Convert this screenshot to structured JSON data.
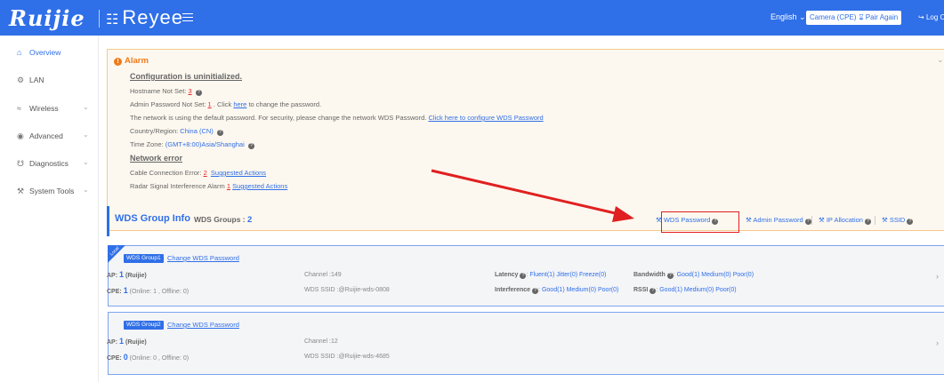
{
  "header": {
    "brand": "Ruijie",
    "product": "Reyee",
    "language": "English",
    "mode": "Camera (CPE)",
    "pair": "Pair Again",
    "logout": "Log O"
  },
  "sidebar": {
    "items": [
      {
        "label": "Overview",
        "icon": "home-icon"
      },
      {
        "label": "LAN",
        "icon": "gear-icon"
      },
      {
        "label": "Wireless",
        "icon": "wifi-icon"
      },
      {
        "label": "Advanced",
        "icon": "globe-icon"
      },
      {
        "label": "Diagnostics",
        "icon": "diagnostics-icon"
      },
      {
        "label": "System Tools",
        "icon": "tools-icon"
      }
    ]
  },
  "alarm": {
    "title": "Alarm",
    "config_heading": "Configuration is uninitialized.",
    "hostname_label": "Hostname Not Set:",
    "hostname_count": "3",
    "admin_label": "Admin Password Not Set:",
    "admin_count": "1",
    "admin_click": ". Click",
    "admin_here": "here",
    "admin_rest": "to change the password.",
    "network_msg": "The network is using the default password. For security, please change the network WDS Password.",
    "network_link": "Click here to configure WDS Password",
    "country_label": "Country/Region:",
    "country_value": "China (CN)",
    "timezone_label": "Time Zone:",
    "timezone_value": "(GMT+8:00)Asia/Shanghai",
    "network_error_heading": "Network error",
    "cable_label": "Cable Connection Error:",
    "cable_count": "2",
    "cable_link": "Suggested Actions",
    "radar_label": "Radar Signal Interference Alarm",
    "radar_count": "1",
    "radar_link": "Suggested Actions"
  },
  "wds": {
    "title": "WDS Group Info",
    "groups_label": "WDS Groups :",
    "groups_count": "2",
    "tools": {
      "wds_password": "WDS Password",
      "admin_password": "Admin Password",
      "ip_allocation": "IP Allocation",
      "ssid": "SSID"
    },
    "local_tag": "Local",
    "change_label": "Change WDS Password",
    "groups": [
      {
        "name": "WDS Group1",
        "ap_label": "AP:",
        "ap_count": "1",
        "ap_name": "(Ruijie)",
        "cpe_label": "CPE:",
        "cpe_count": "1",
        "cpe_detail": "(Online: 1 , Offline: 0)",
        "channel": "Channel :149",
        "ssid": "WDS SSID :@Ruijie-wds-0808",
        "latency_label": "Latency",
        "latency_value": "Fluent(1)  Jitter(0)  Freeze(0)",
        "interference_label": "Interference",
        "interference_value": "Good(1)  Medium(0)  Poor(0)",
        "bandwidth_label": "Bandwidth",
        "bandwidth_value": "Good(1)  Medium(0)  Poor(0)",
        "rssi_label": "RSSI",
        "rssi_value": "Good(1)  Medium(0)  Poor(0)"
      },
      {
        "name": "WDS Group2",
        "ap_label": "AP:",
        "ap_count": "1",
        "ap_name": "(Ruijie)",
        "cpe_label": "CPE:",
        "cpe_count": "0",
        "cpe_detail": "(Online: 0 , Offline: 0)",
        "channel": "Channel :12",
        "ssid": "WDS SSID :@Ruijie-wds-4685"
      }
    ]
  },
  "colors": {
    "primary": "#2f6fe8",
    "alarm_orange": "#ef7a1a",
    "alarm_red": "#e02a2a"
  }
}
